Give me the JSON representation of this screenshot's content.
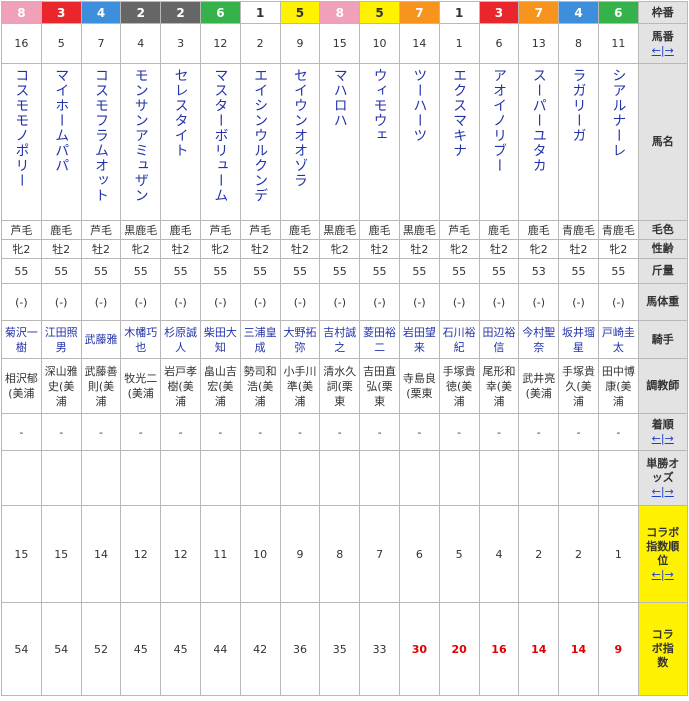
{
  "header": {
    "waku": "枠番",
    "umaban": "馬番",
    "name": "馬名",
    "coat": "毛色",
    "sexage": "性齢",
    "weight_carried": "斤量",
    "body_weight": "馬体重",
    "jockey": "騎手",
    "trainer": "調教師",
    "finish": "着順",
    "odds": "単勝オッズ",
    "collab_rank": "コラボ指数順位",
    "collab_index": "コラボ指数",
    "nav_left": "←",
    "nav_sep": "|",
    "nav_right": "→"
  },
  "colors": {
    "waku": {
      "1": {
        "bg": "#ffffff",
        "fg": "#333333"
      },
      "2": {
        "bg": "#666666",
        "fg": "#ffffff"
      },
      "3": {
        "bg": "#e8262b",
        "fg": "#ffffff"
      },
      "4": {
        "bg": "#3d8edb",
        "fg": "#ffffff"
      },
      "5": {
        "bg": "#fff200",
        "fg": "#333333"
      },
      "6": {
        "bg": "#35b34a",
        "fg": "#ffffff"
      },
      "7": {
        "bg": "#f7941d",
        "fg": "#ffffff"
      },
      "8": {
        "bg": "#f0a0b8",
        "fg": "#ffffff"
      }
    },
    "highlight": "#e00000"
  },
  "horses": [
    {
      "waku": "8",
      "umaban": "16",
      "name": "コスモモノポリー",
      "coat": "芦毛",
      "sexage": "牝2",
      "kin": "55",
      "bw": "(-)",
      "jockey": "菊沢一樹",
      "trainer": "相沢郁(美浦",
      "finish": "-",
      "rank": "15",
      "index": "54",
      "hl": false
    },
    {
      "waku": "3",
      "umaban": "5",
      "name": "マイホームパパ",
      "coat": "鹿毛",
      "sexage": "牡2",
      "kin": "55",
      "bw": "(-)",
      "jockey": "江田照男",
      "trainer": "深山雅史(美浦",
      "finish": "-",
      "rank": "15",
      "index": "54",
      "hl": false
    },
    {
      "waku": "4",
      "umaban": "7",
      "name": "コスモフラムオット",
      "coat": "芦毛",
      "sexage": "牡2",
      "kin": "55",
      "bw": "(-)",
      "jockey": "武藤雅",
      "trainer": "武藤善則(美浦",
      "finish": "-",
      "rank": "14",
      "index": "52",
      "hl": false
    },
    {
      "waku": "2",
      "umaban": "4",
      "name": "モンサンアミュザン",
      "coat": "黒鹿毛",
      "sexage": "牝2",
      "kin": "55",
      "bw": "(-)",
      "jockey": "木幡巧也",
      "trainer": "牧光二(美浦",
      "finish": "-",
      "rank": "12",
      "index": "45",
      "hl": false
    },
    {
      "waku": "2",
      "umaban": "3",
      "name": "セレスタイト",
      "coat": "鹿毛",
      "sexage": "牡2",
      "kin": "55",
      "bw": "(-)",
      "jockey": "杉原誠人",
      "trainer": "岩戸孝樹(美浦",
      "finish": "-",
      "rank": "12",
      "index": "45",
      "hl": false
    },
    {
      "waku": "6",
      "umaban": "12",
      "name": "マスターボリューム",
      "coat": "芦毛",
      "sexage": "牝2",
      "kin": "55",
      "bw": "(-)",
      "jockey": "柴田大知",
      "trainer": "畠山吉宏(美浦",
      "finish": "-",
      "rank": "11",
      "index": "44",
      "hl": false
    },
    {
      "waku": "1",
      "umaban": "2",
      "name": "エイシンウルクンデ",
      "coat": "芦毛",
      "sexage": "牡2",
      "kin": "55",
      "bw": "(-)",
      "jockey": "三浦皇成",
      "trainer": "勢司和浩(美浦",
      "finish": "-",
      "rank": "10",
      "index": "42",
      "hl": false
    },
    {
      "waku": "5",
      "umaban": "9",
      "name": "セイウンオオゾラ",
      "coat": "鹿毛",
      "sexage": "牡2",
      "kin": "55",
      "bw": "(-)",
      "jockey": "大野拓弥",
      "trainer": "小手川準(美浦",
      "finish": "-",
      "rank": "9",
      "index": "36",
      "hl": false
    },
    {
      "waku": "8",
      "umaban": "15",
      "name": "マハロハ",
      "coat": "黒鹿毛",
      "sexage": "牝2",
      "kin": "55",
      "bw": "(-)",
      "jockey": "吉村誠之",
      "trainer": "清水久詞(栗東",
      "finish": "-",
      "rank": "8",
      "index": "35",
      "hl": false
    },
    {
      "waku": "5",
      "umaban": "10",
      "name": "ウィモウェ",
      "coat": "鹿毛",
      "sexage": "牡2",
      "kin": "55",
      "bw": "(-)",
      "jockey": "菱田裕二",
      "trainer": "吉田直弘(栗東",
      "finish": "-",
      "rank": "7",
      "index": "33",
      "hl": false
    },
    {
      "waku": "7",
      "umaban": "14",
      "name": "ツーハーツ",
      "coat": "黒鹿毛",
      "sexage": "牡2",
      "kin": "55",
      "bw": "(-)",
      "jockey": "岩田望来",
      "trainer": "寺島良(栗東",
      "finish": "-",
      "rank": "6",
      "index": "30",
      "hl": true
    },
    {
      "waku": "1",
      "umaban": "1",
      "name": "エクスマキナ",
      "coat": "芦毛",
      "sexage": "牝2",
      "kin": "55",
      "bw": "(-)",
      "jockey": "石川裕紀",
      "trainer": "手塚貴徳(美浦",
      "finish": "-",
      "rank": "5",
      "index": "20",
      "hl": true
    },
    {
      "waku": "3",
      "umaban": "6",
      "name": "アオイノリブー",
      "coat": "鹿毛",
      "sexage": "牡2",
      "kin": "55",
      "bw": "(-)",
      "jockey": "田辺裕信",
      "trainer": "尾形和幸(美浦",
      "finish": "-",
      "rank": "4",
      "index": "16",
      "hl": true
    },
    {
      "waku": "7",
      "umaban": "13",
      "name": "スーパーユタカ",
      "coat": "鹿毛",
      "sexage": "牝2",
      "kin": "53",
      "bw": "(-)",
      "jockey": "今村聖奈",
      "trainer": "武井亮(美浦",
      "finish": "-",
      "rank": "2",
      "index": "14",
      "hl": true
    },
    {
      "waku": "4",
      "umaban": "8",
      "name": "ラガリーガ",
      "coat": "青鹿毛",
      "sexage": "牡2",
      "kin": "55",
      "bw": "(-)",
      "jockey": "坂井瑠星",
      "trainer": "手塚貴久(美浦",
      "finish": "-",
      "rank": "2",
      "index": "14",
      "hl": true
    },
    {
      "waku": "6",
      "umaban": "11",
      "name": "シアルナーレ",
      "coat": "青鹿毛",
      "sexage": "牝2",
      "kin": "55",
      "bw": "(-)",
      "jockey": "戸崎圭太",
      "trainer": "田中博康(美浦",
      "finish": "-",
      "rank": "1",
      "index": "9",
      "hl": true
    }
  ]
}
